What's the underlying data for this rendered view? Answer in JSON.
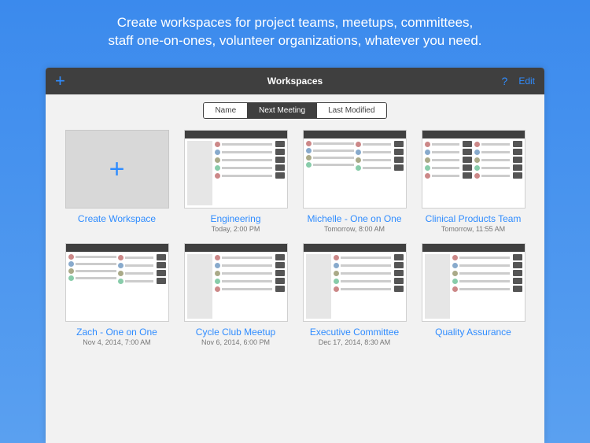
{
  "intro_line1": "Create workspaces for project teams, meetups, committees,",
  "intro_line2": "staff one-on-ones, volunteer organizations, whatever you need.",
  "toolbar": {
    "title": "Workspaces",
    "add_glyph": "+",
    "help_glyph": "?",
    "edit_label": "Edit"
  },
  "segments": {
    "name": "Name",
    "next": "Next Meeting",
    "last": "Last Modified",
    "active": "next"
  },
  "cards": [
    {
      "kind": "create",
      "title": "Create Workspace",
      "subtitle": ""
    },
    {
      "kind": "ws",
      "layout": "side",
      "title": "Engineering",
      "subtitle": "Today, 2:00 PM"
    },
    {
      "kind": "ws",
      "layout": "cols",
      "title": "Michelle - One on One",
      "subtitle": "Tomorrow, 8:00 AM"
    },
    {
      "kind": "ws",
      "layout": "wide",
      "title": "Clinical Products Team",
      "subtitle": "Tomorrow, 11:55 AM"
    },
    {
      "kind": "ws",
      "layout": "cols",
      "title": "Zach - One on One",
      "subtitle": "Nov 4, 2014, 7:00 AM"
    },
    {
      "kind": "ws",
      "layout": "side",
      "title": "Cycle Club Meetup",
      "subtitle": "Nov 6, 2014, 6:00 PM"
    },
    {
      "kind": "ws",
      "layout": "side",
      "title": "Executive Committee",
      "subtitle": "Dec 17, 2014, 8:30 AM"
    },
    {
      "kind": "ws",
      "layout": "side",
      "title": "Quality Assurance",
      "subtitle": ""
    }
  ]
}
